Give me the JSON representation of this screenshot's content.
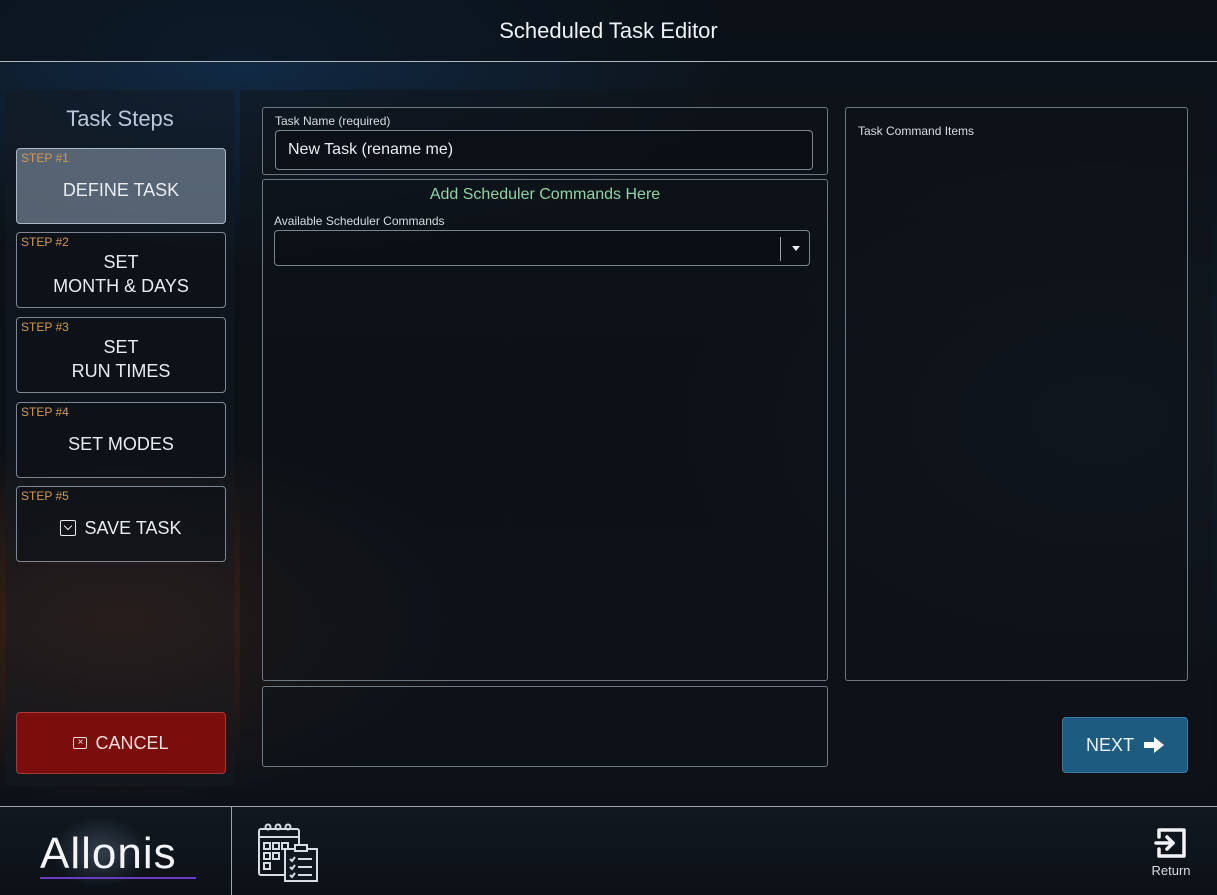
{
  "header": {
    "title": "Scheduled Task Editor"
  },
  "steps": {
    "title": "Task Steps",
    "items": [
      {
        "num": "STEP #1",
        "lines": [
          "DEFINE TASK"
        ],
        "active": true
      },
      {
        "num": "STEP #2",
        "lines": [
          "SET",
          "MONTH & DAYS"
        ],
        "active": false
      },
      {
        "num": "STEP #3",
        "lines": [
          "SET",
          "RUN TIMES"
        ],
        "active": false
      },
      {
        "num": "STEP #4",
        "lines": [
          "SET MODES"
        ],
        "active": false
      },
      {
        "num": "STEP #5",
        "lines": [
          "SAVE TASK"
        ],
        "active": false,
        "icon": "save-icon"
      }
    ],
    "cancel_label": "CANCEL"
  },
  "task_name": {
    "label": "Task Name (required)",
    "value": "New Task (rename me)"
  },
  "commands": {
    "title": "Add Scheduler Commands Here",
    "select_label": "Available Scheduler Commands",
    "selected_value": ""
  },
  "command_items": {
    "label": "Task Command Items"
  },
  "next_label": "NEXT",
  "footer": {
    "logo": "Allonis",
    "return_label": "Return"
  },
  "colors": {
    "accent_green": "#8fd3a6",
    "step_number": "#d39a55",
    "cancel": "#7c0d0d",
    "next": "#1e5b80"
  }
}
